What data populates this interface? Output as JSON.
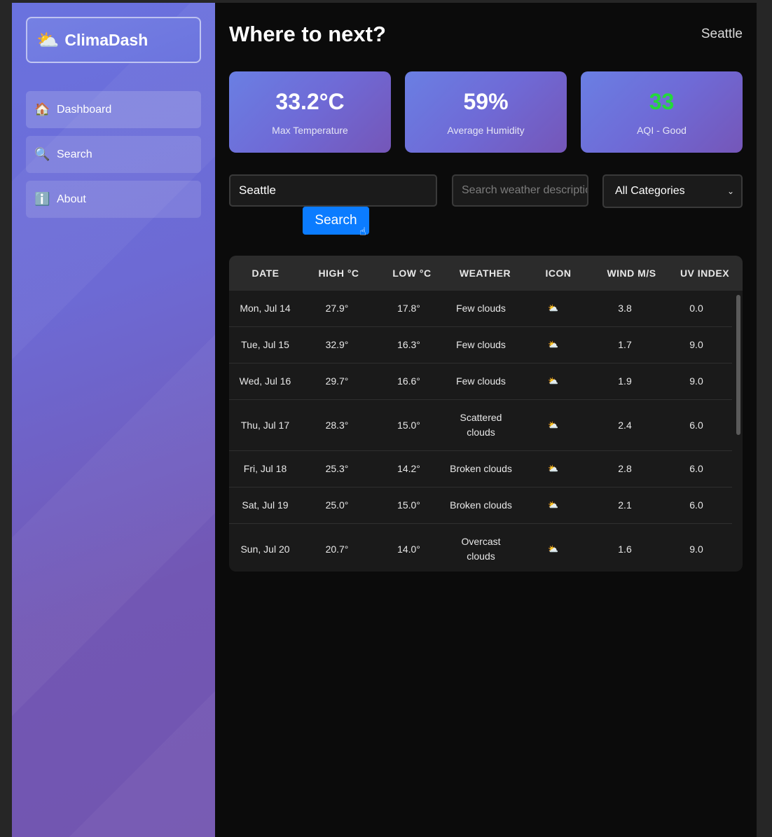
{
  "sidebar": {
    "brand": {
      "icon": "⛅",
      "name": "ClimaDash"
    },
    "items": [
      {
        "icon": "🏠",
        "label": "Dashboard"
      },
      {
        "icon": "🔍",
        "label": "Search"
      },
      {
        "icon": "ℹ️",
        "label": "About"
      }
    ]
  },
  "header": {
    "title": "Where to next?",
    "city": "Seattle"
  },
  "stats": [
    {
      "value": "33.2°C",
      "label": "Max Temperature",
      "color": "#ffffff"
    },
    {
      "value": "59%",
      "label": "Average Humidity",
      "color": "#ffffff"
    },
    {
      "value": "33",
      "label": "AQI - Good",
      "color": "#23d83b"
    }
  ],
  "controls": {
    "city_value": "Seattle",
    "description_placeholder": "Search weather description",
    "category_selected": "All Categories",
    "search_label": "Search"
  },
  "table": {
    "headers": [
      "DATE",
      "HIGH °C",
      "LOW °C",
      "WEATHER",
      "ICON",
      "WIND M/S",
      "UV INDEX"
    ],
    "rows": [
      {
        "date": "Mon, Jul 14",
        "high": "27.9°",
        "low": "17.8°",
        "weather": "Few clouds",
        "icon": "⛅",
        "wind": "3.8",
        "uv": "0.0"
      },
      {
        "date": "Tue, Jul 15",
        "high": "32.9°",
        "low": "16.3°",
        "weather": "Few clouds",
        "icon": "⛅",
        "wind": "1.7",
        "uv": "9.0"
      },
      {
        "date": "Wed, Jul 16",
        "high": "29.7°",
        "low": "16.6°",
        "weather": "Few clouds",
        "icon": "⛅",
        "wind": "1.9",
        "uv": "9.0"
      },
      {
        "date": "Thu, Jul 17",
        "high": "28.3°",
        "low": "15.0°",
        "weather": "Scattered clouds",
        "icon": "⛅",
        "wind": "2.4",
        "uv": "6.0"
      },
      {
        "date": "Fri, Jul 18",
        "high": "25.3°",
        "low": "14.2°",
        "weather": "Broken clouds",
        "icon": "⛅",
        "wind": "2.8",
        "uv": "6.0"
      },
      {
        "date": "Sat, Jul 19",
        "high": "25.0°",
        "low": "15.0°",
        "weather": "Broken clouds",
        "icon": "⛅",
        "wind": "2.1",
        "uv": "6.0"
      },
      {
        "date": "Sun, Jul 20",
        "high": "20.7°",
        "low": "14.0°",
        "weather": "Overcast clouds",
        "icon": "⛅",
        "wind": "1.6",
        "uv": "9.0"
      }
    ]
  }
}
